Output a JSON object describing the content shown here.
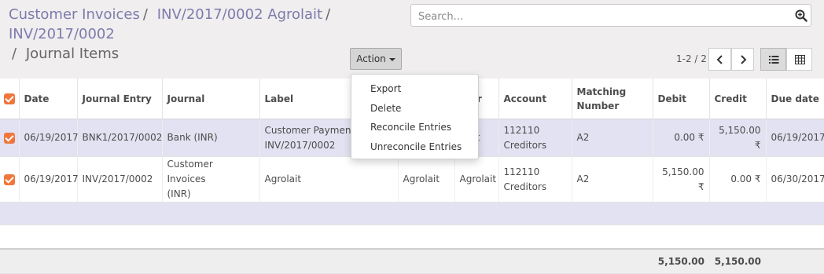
{
  "breadcrumb": {
    "items": [
      "Customer Invoices",
      "INV/2017/0002 Agrolait",
      "INV/2017/0002"
    ],
    "active": "Journal Items",
    "separator": "/"
  },
  "search": {
    "placeholder": "Search...",
    "icon": "search-plus-icon"
  },
  "toolbar": {
    "action_label": "Action"
  },
  "pager": {
    "value": "1-2 / 2"
  },
  "menu": {
    "items": [
      "Export",
      "Delete",
      "Reconcile Entries",
      "Unreconcile Entries"
    ]
  },
  "table": {
    "headers": [
      "Date",
      "Journal Entry",
      "Journal",
      "Label",
      "",
      "tner",
      "Account",
      "Matching Number",
      "Debit",
      "Credit",
      "Due date"
    ],
    "rows": [
      {
        "date": "06/19/2017",
        "journal_entry": "BNK1/2017/0002",
        "journal": "Bank (INR)",
        "label_line1": "Customer Payment",
        "label_line2": "INV/2017/0002",
        "ref": "",
        "partner": "olait",
        "account_line1": "112110",
        "account_line2": "Creditors",
        "matching": "A2",
        "debit": "0.00 ₹",
        "credit": "5,150.00 ₹",
        "due_date": "06/19/2017"
      },
      {
        "date": "06/19/2017",
        "journal_entry": "INV/2017/0002",
        "journal_line1": "Customer Invoices",
        "journal_line2": "(INR)",
        "label": "Agrolait",
        "ref": "Agrolait",
        "partner": "Agrolait",
        "account_line1": "112110",
        "account_line2": "Creditors",
        "matching": "A2",
        "debit": "5,150.00 ₹",
        "credit": "0.00 ₹",
        "due_date": "06/30/2017"
      }
    ],
    "totals": {
      "debit": "5,150.00",
      "credit": "5,150.00"
    }
  },
  "colors": {
    "accent": "#7c7bad",
    "checkbox": "#f0763c",
    "selected_row": "#e2e2f2"
  }
}
